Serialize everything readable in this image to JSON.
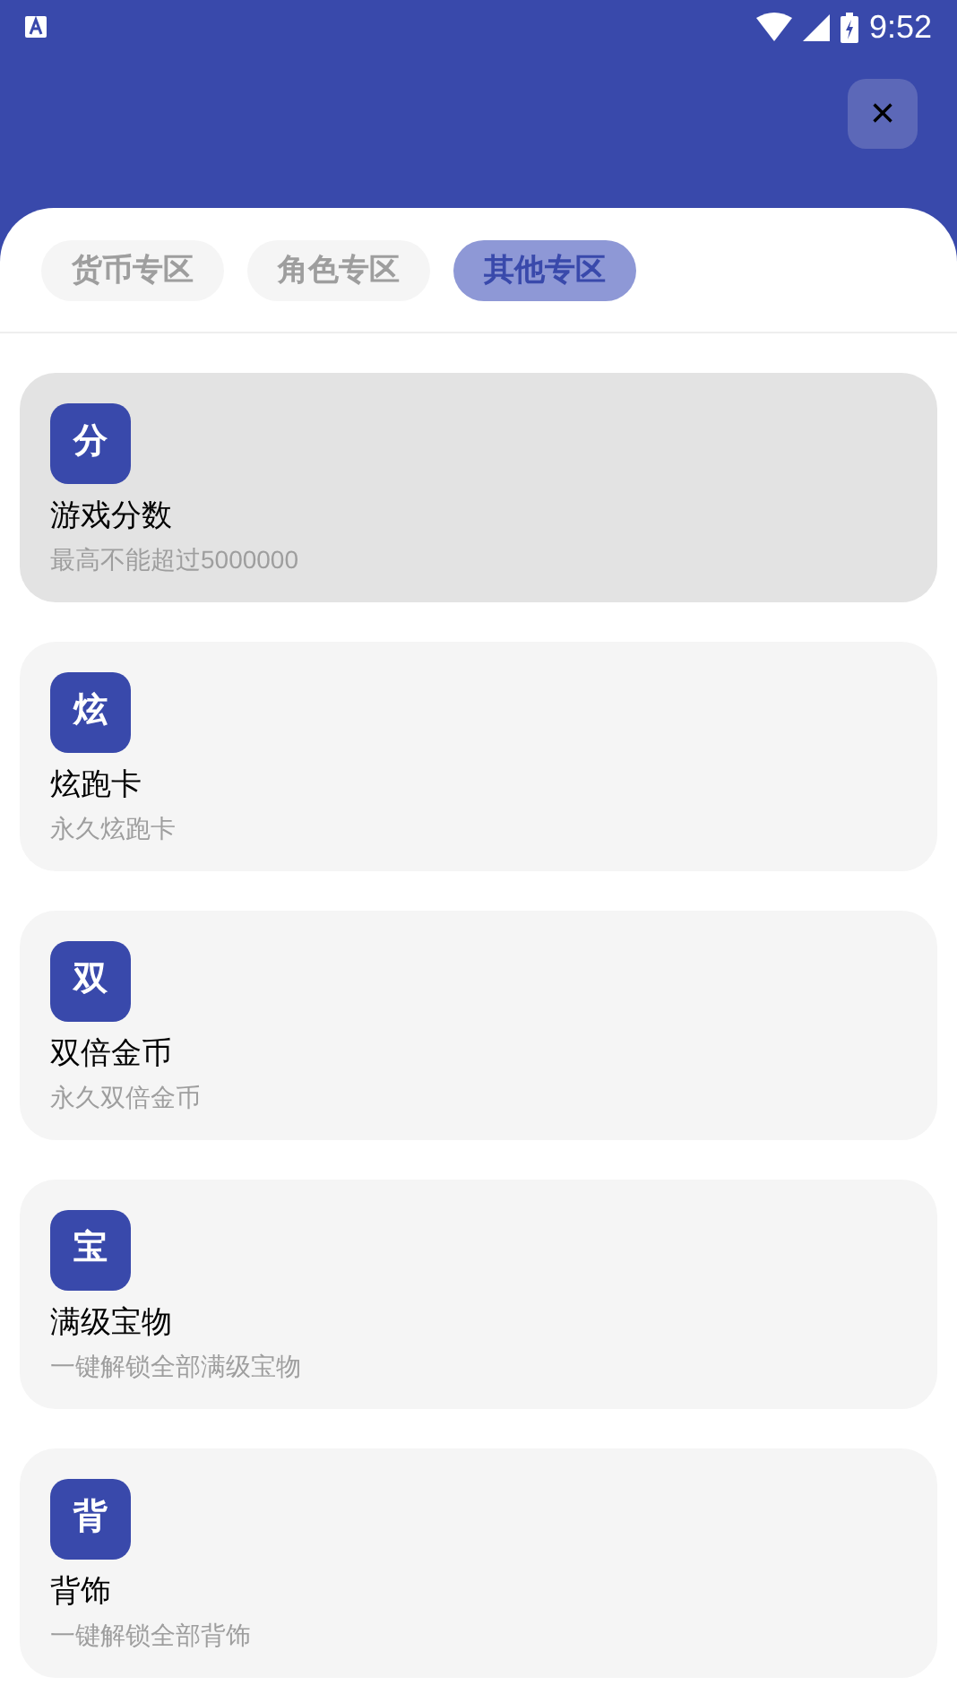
{
  "status_bar": {
    "time": "9:52"
  },
  "close_button": {
    "label": "×"
  },
  "tabs": [
    {
      "label": "货币专区",
      "selected": false
    },
    {
      "label": "角色专区",
      "selected": false
    },
    {
      "label": "其他专区",
      "selected": true
    }
  ],
  "items": [
    {
      "icon": "分",
      "title": "游戏分数",
      "subtitle": "最高不能超过5000000",
      "selected": true
    },
    {
      "icon": "炫",
      "title": "炫跑卡",
      "subtitle": "永久炫跑卡",
      "selected": false
    },
    {
      "icon": "双",
      "title": "双倍金币",
      "subtitle": "永久双倍金币",
      "selected": false
    },
    {
      "icon": "宝",
      "title": "满级宝物",
      "subtitle": "一键解锁全部满级宝物",
      "selected": false
    },
    {
      "icon": "背",
      "title": "背饰",
      "subtitle": "一键解锁全部背饰",
      "selected": false
    }
  ]
}
